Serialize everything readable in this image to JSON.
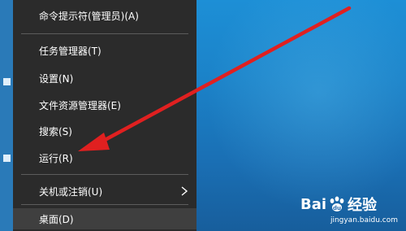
{
  "menu": {
    "items": [
      {
        "id": "cmd-admin",
        "label": "命令提示符(管理员)(A)"
      },
      {
        "id": "task-manager",
        "label": "任务管理器(T)"
      },
      {
        "id": "settings",
        "label": "设置(N)"
      },
      {
        "id": "file-explorer",
        "label": "文件资源管理器(E)"
      },
      {
        "id": "search",
        "label": "搜索(S)"
      },
      {
        "id": "run",
        "label": "运行(R)"
      },
      {
        "id": "shutdown",
        "label": "关机或注销(U)"
      },
      {
        "id": "desktop",
        "label": "桌面(D)"
      }
    ]
  },
  "annotation": {
    "arrow_color": "#e02020"
  },
  "watermark": {
    "brand_left": "Bai",
    "brand_right": "经验",
    "url": "jingyan.baidu.com"
  },
  "colors": {
    "menu_bg": "#2b2b2b",
    "menu_text": "#ffffff",
    "desktop_blue": "#1b82c8"
  }
}
